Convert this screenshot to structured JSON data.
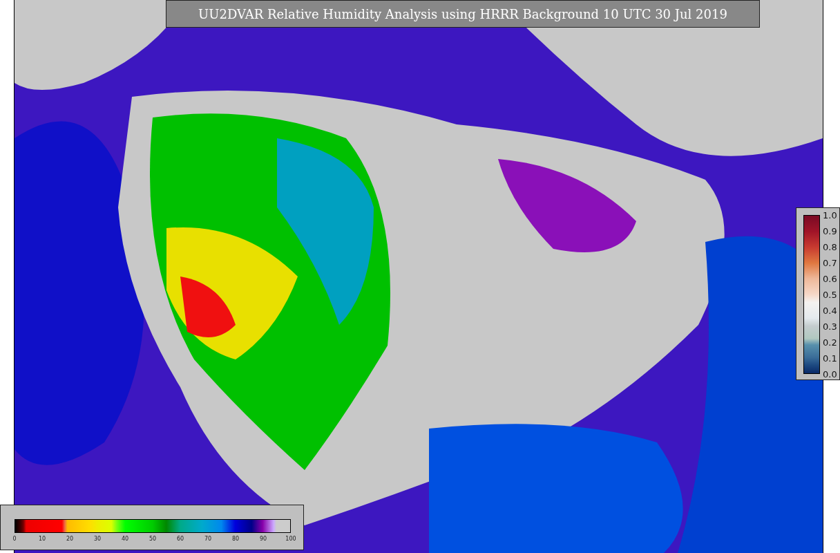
{
  "title": "UU2DVAR Relative Humidity Analysis using HRRR Background 10 UTC 30 Jul 2019",
  "humidity_colorbar": {
    "ticks": [
      "0",
      "10",
      "20",
      "30",
      "40",
      "50",
      "60",
      "70",
      "80",
      "90",
      "100"
    ]
  },
  "ratio_colorbar": {
    "ticks": [
      "1.0",
      "0.9",
      "0.8",
      "0.7",
      "0.6",
      "0.5",
      "0.4",
      "0.3",
      "0.2",
      "0.1",
      "0.0"
    ]
  }
}
